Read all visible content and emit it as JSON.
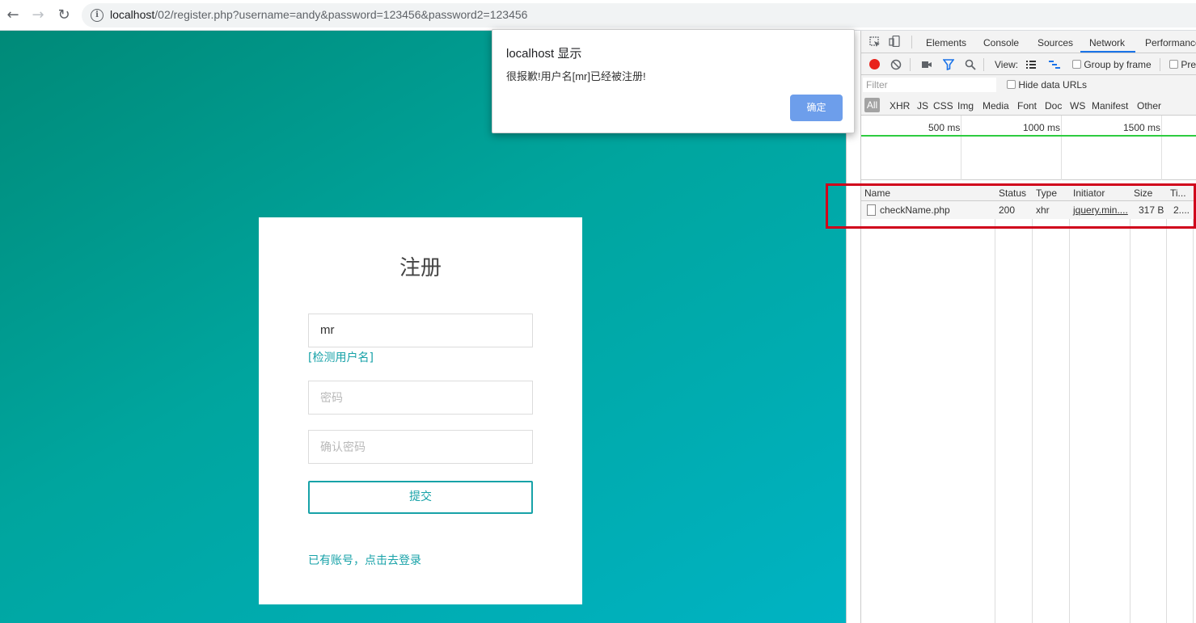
{
  "browser": {
    "url_host": "localhost",
    "url_rest": "/02/register.php?username=andy&password=123456&password2=123456"
  },
  "form": {
    "title": "注册",
    "username_value": "mr",
    "check_link": "[检测用户名]",
    "password_placeholder": "密码",
    "confirm_placeholder": "确认密码",
    "submit_label": "提交",
    "login_link": "已有账号，点击去登录"
  },
  "alert": {
    "title": "localhost 显示",
    "message": "很报歉!用户名[mr]已经被注册!",
    "ok_label": "确定"
  },
  "devtools": {
    "tabs": [
      "Elements",
      "Console",
      "Sources",
      "Network",
      "Performance"
    ],
    "active_tab": "Network",
    "view_label": "View:",
    "group_by_frame": "Group by frame",
    "preserve_log": "Pre",
    "filter_placeholder": "Filter",
    "hide_data_urls": "Hide data URLs",
    "types": [
      "All",
      "XHR",
      "JS",
      "CSS",
      "Img",
      "Media",
      "Font",
      "Doc",
      "WS",
      "Manifest",
      "Other"
    ],
    "ticks": [
      "500 ms",
      "1000 ms",
      "1500 ms"
    ],
    "columns": [
      "Name",
      "Status",
      "Type",
      "Initiator",
      "Size",
      "Ti..."
    ],
    "rows": [
      {
        "name": "checkName.php",
        "status": "200",
        "type": "xhr",
        "initiator": "jquery.min....",
        "size": "317 B",
        "time": "2...."
      }
    ]
  },
  "colors": {
    "accent": "#17a2a8",
    "alert_button": "#6d9eeb",
    "highlight": "#d0021b"
  }
}
